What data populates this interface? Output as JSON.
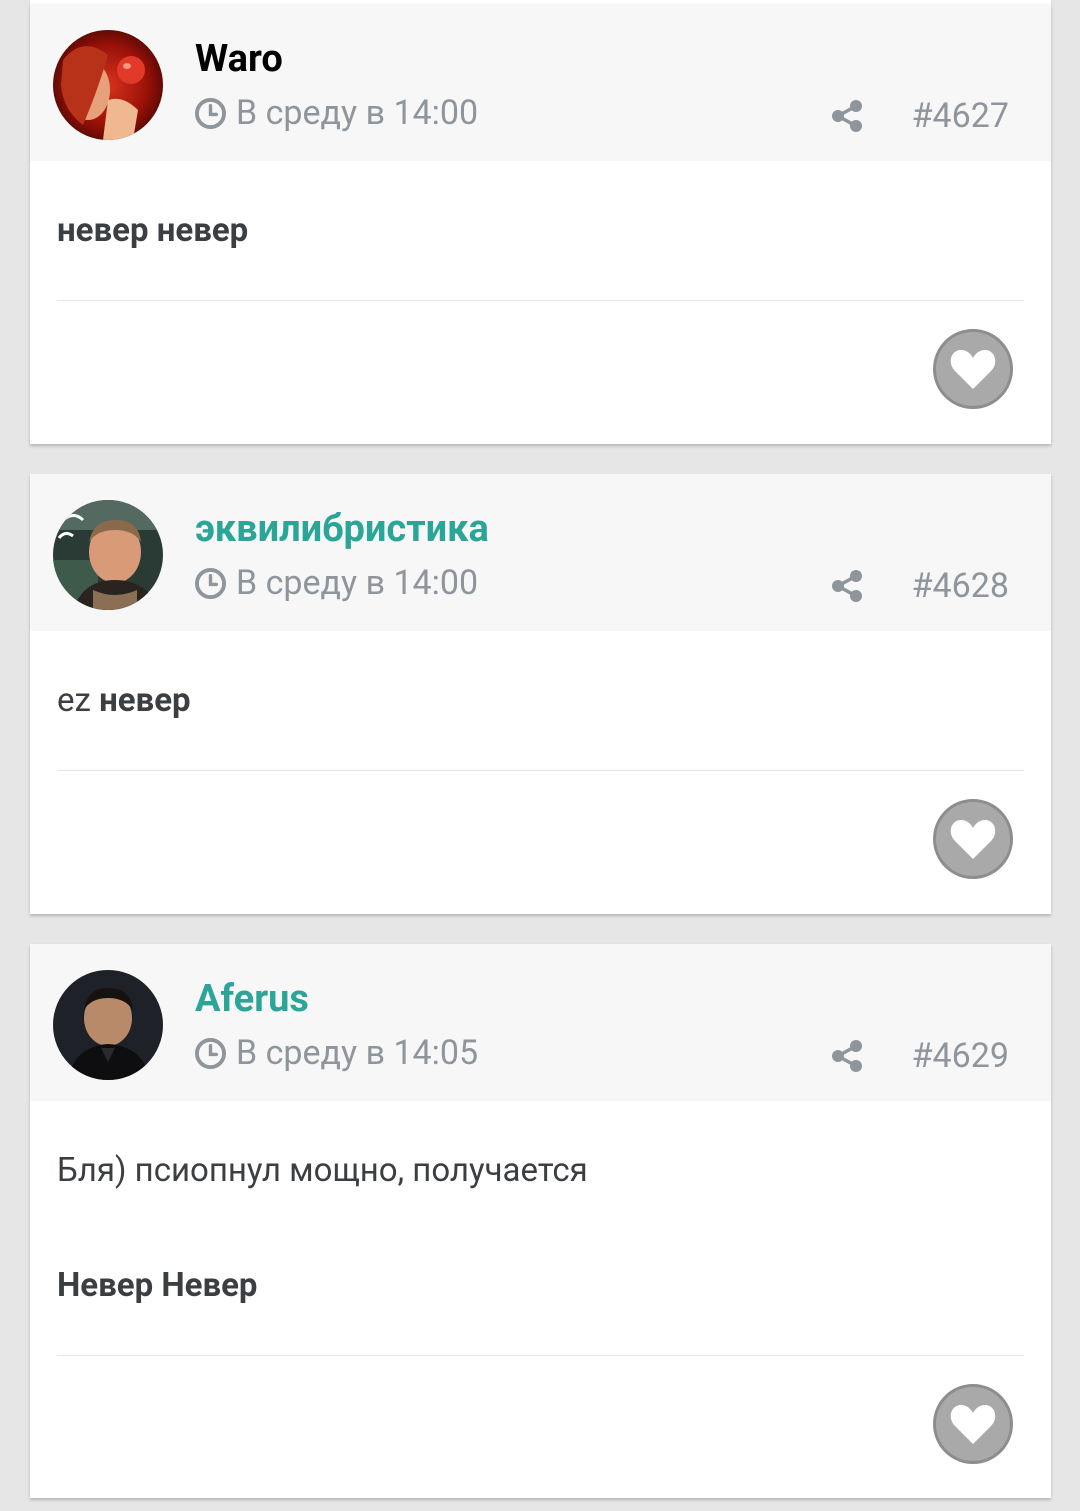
{
  "colors": {
    "page_bg": "#e6e6e6",
    "header_bg": "#f7f7f7",
    "accent_teal": "#2aa597",
    "username_dark": "#000000",
    "meta_gray": "#8e959c",
    "like_gray": "#a9a9a9"
  },
  "posts": [
    {
      "username": "Waro",
      "username_color": "#000000",
      "timestamp": "В среду в 14:00",
      "post_number": "#4627",
      "avatar_icon": "avatar-red-fantasy-woman",
      "content": {
        "line1_plain": "",
        "line1_bold": "невер невер"
      }
    },
    {
      "username": "эквилибристика",
      "username_color": "#2aa597",
      "timestamp": "В среду в 14:00",
      "post_number": "#4628",
      "avatar_icon": "avatar-man-portrait",
      "content": {
        "line1_plain": "ez ",
        "line1_bold": "невер"
      }
    },
    {
      "username": "Aferus",
      "username_color": "#2aa597",
      "timestamp": "В среду в 14:05",
      "post_number": "#4629",
      "avatar_icon": "avatar-man-dark-suit",
      "content": {
        "line1_plain": "Бля) псиопнул мощно, получается",
        "line2_bold": "Невер Невер"
      }
    }
  ]
}
